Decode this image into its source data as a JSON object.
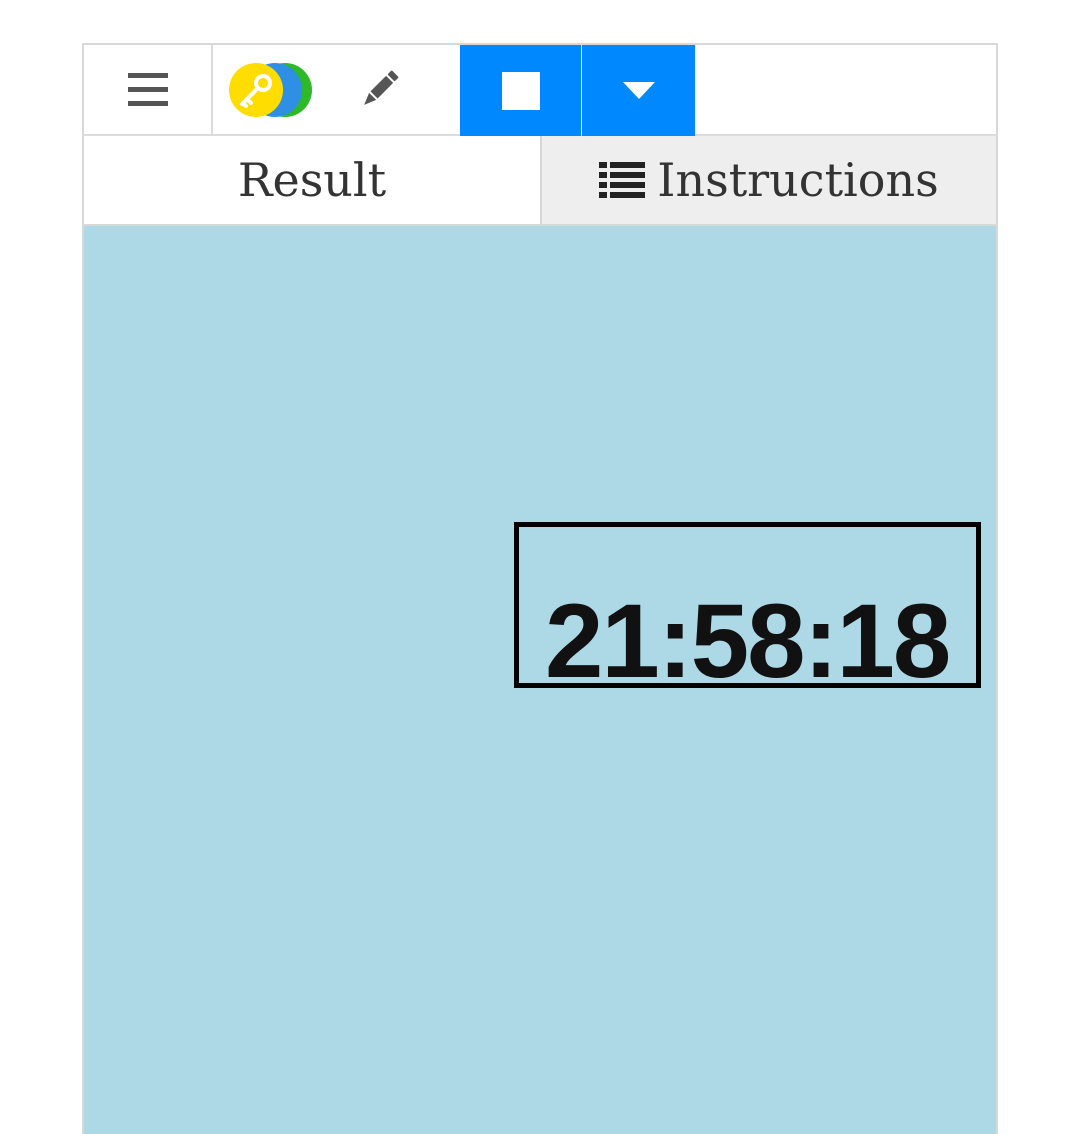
{
  "toolbar": {
    "menu_icon": "hamburger-menu-icon",
    "key_icon": "key-icon",
    "pencil_icon": "pencil-icon",
    "stop_icon": "stop-square-icon",
    "dropdown_icon": "caret-down-icon",
    "accent_color": "#0088ff"
  },
  "tabs": [
    {
      "label": "Result",
      "active": true
    },
    {
      "label": "Instructions",
      "icon": "list-icon",
      "active": false
    }
  ],
  "result": {
    "background_color": "#add8e6",
    "clock_text": "21:58:18"
  }
}
